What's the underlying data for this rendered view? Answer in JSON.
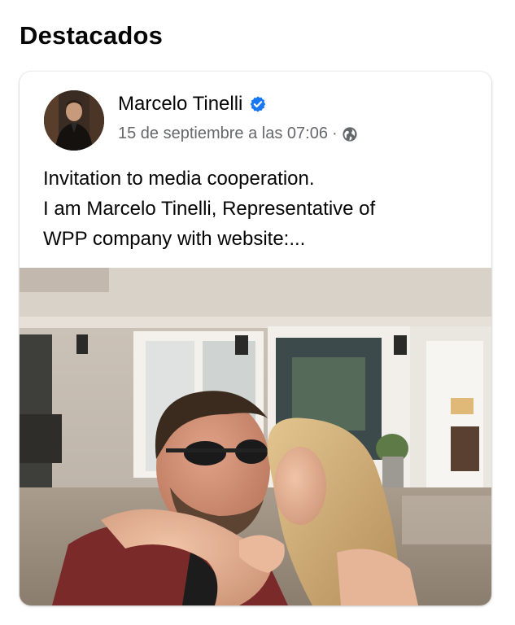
{
  "section": {
    "title": "Destacados"
  },
  "post": {
    "author": "Marcelo Tinelli",
    "verified_icon": "verified-badge-icon",
    "date": "15 de septiembre a las 07:06",
    "separator": "·",
    "audience_icon": "globe-icon",
    "text_lines": [
      "Invitation to media cooperation.",
      "I am Marcelo Tinelli, Representative of",
      "WPP company with website:..."
    ]
  },
  "colors": {
    "verified": "#1877f2",
    "meta_text": "#65676b",
    "text": "#050505"
  }
}
